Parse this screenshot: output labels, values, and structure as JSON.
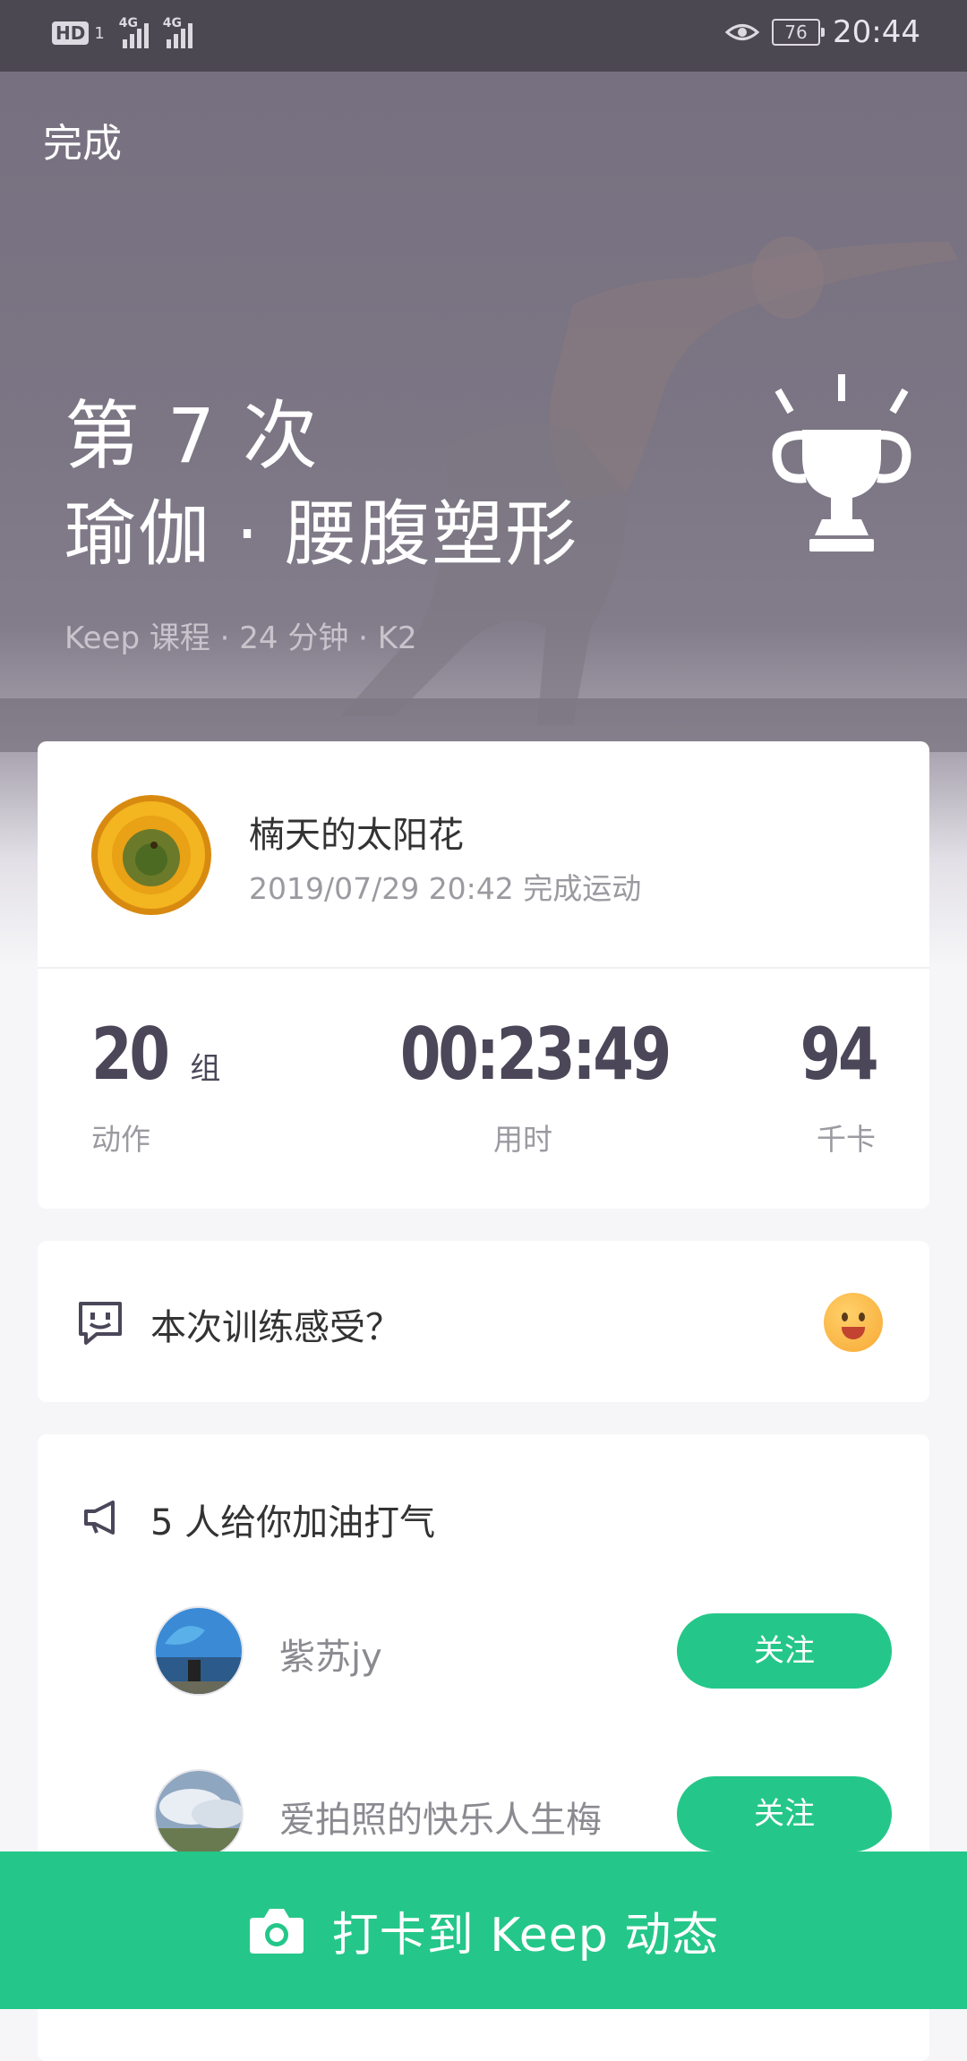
{
  "status_bar": {
    "hd": "HD",
    "sim": "1",
    "net1": "4G",
    "net2": "4G",
    "battery": "76",
    "time": "20:44"
  },
  "hero": {
    "done": "完成",
    "count": "第 7 次",
    "title": "瑜伽 · 腰腹塑形",
    "meta": "Keep 课程 · 24 分钟 · K2"
  },
  "summary": {
    "user_name": "楠天的太阳花",
    "finish_time": "2019/07/29 20:42 完成运动",
    "stats": {
      "actions_value": "20",
      "actions_unit": "组",
      "actions_label": "动作",
      "time_value": "00:23:49",
      "time_label": "用时",
      "calories_value": "94",
      "calories_label": "千卡"
    }
  },
  "feeling": {
    "prompt": "本次训练感受？"
  },
  "cheer": {
    "title": "5 人给你加油打气",
    "fans": [
      {
        "name": "紫苏jy",
        "button": "关注"
      },
      {
        "name": "爱拍照的快乐人生梅",
        "button": "关注"
      }
    ]
  },
  "checkin": {
    "label": "打卡到 Keep 动态"
  },
  "colors": {
    "accent": "#24c789",
    "hero_bg": "#7b7584",
    "stat_text": "#4b4759"
  }
}
